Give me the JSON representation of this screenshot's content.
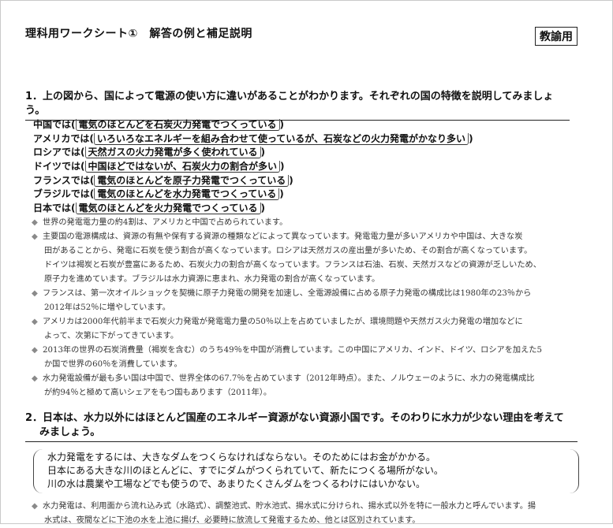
{
  "header": {
    "title": "理科用ワークシート①　解答の例と補足説明",
    "badge": "教諭用"
  },
  "q1": {
    "question": "1．上の図から、国によって電源の使い方に違いがあることがわかります。それぞれの国の特徴を説明してみましょう。",
    "answers": [
      {
        "country": "中国では",
        "answer": "電気のほとんどを石炭火力発電でつくっている"
      },
      {
        "country": "アメリカでは",
        "answer": "いろいろなエネルギーを組み合わせて使っているが、石炭などの火力発電がかなり多い"
      },
      {
        "country": "ロシアでは",
        "answer": "天然ガスの火力発電が多く使われている"
      },
      {
        "country": "ドイツでは",
        "answer": "中国ほどではないが、石炭火力の割合が多い"
      },
      {
        "country": "フランスでは",
        "answer": "電気のほとんどを原子力発電でつくっている"
      },
      {
        "country": "ブラジルでは",
        "answer": "電気のほとんどを水力発電でつくっている"
      },
      {
        "country": "日本では",
        "answer": "電気のほとんどを火力発電でつくっている"
      }
    ],
    "notes": [
      {
        "marker": "◆",
        "text": "世界の発電電力量の約4割は、アメリカと中国で占められています。"
      },
      {
        "marker": "◆",
        "text": "主要国の電源構成は、資源の有無や保有する資源の種類などによって異なっています。発電電力量が多いアメリカや中国は、大きな炭"
      },
      {
        "marker": "",
        "text": "田があることから、発電に石炭を使う割合が高くなっています。ロシアは天然ガスの産出量が多いため、その割合が高くなっています。"
      },
      {
        "marker": "",
        "text": "ドイツは褐炭と石炭が豊富にあるため、石炭火力の割合が高くなっています。フランスは石油、石炭、天然ガスなどの資源が乏しいため、"
      },
      {
        "marker": "",
        "text": "原子力を進めています。ブラジルは水力資源に恵まれ、水力発電の割合が高くなっています。"
      },
      {
        "marker": "◆",
        "text": "フランスは、第一次オイルショックを契機に原子力発電の開発を加速し、全電源設備に占める原子力発電の構成比は1980年の23％から"
      },
      {
        "marker": "",
        "text": "2012年は52％に増やしています。"
      },
      {
        "marker": "◆",
        "text": "アメリカは2000年代前半まで石炭火力発電が発電電力量の50％以上を占めていましたが、環境問題や天然ガス火力発電の増加などに"
      },
      {
        "marker": "",
        "text": "よって、次第に下がってきています。"
      },
      {
        "marker": "◆",
        "text": "2013年の世界の石炭消費量（褐炭を含む）のうち49％を中国が消費しています。この中国にアメリカ、インド、ドイツ、ロシアを加えた5"
      },
      {
        "marker": "",
        "text": "か国で世界の60％を消費しています。"
      },
      {
        "marker": "◆",
        "text": "水力発電設備が最も多い国は中国で、世界全体の67.7％を占めています（2012年時点）。また、ノルウェーのように、水力の発電構成比"
      },
      {
        "marker": "",
        "text": "が約94％と極めて高いシェアをもつ国もあります（2011年）。"
      }
    ]
  },
  "q2": {
    "question_line1": "2．日本は、水力以外にはほとんど国産のエネルギー資源がない資源小国です。そのわりに水力が少ない理由を考えて",
    "question_line2": "みましょう。",
    "answer_lines": [
      "水力発電をするには、大きなダムをつくらなければならない。そのためにはお金がかかる。",
      "日本にある大きな川のほとんどに、すでにダムがつくられていて、新たにつくる場所がない。",
      "川の水は農業や工場などでも使うので、あまりたくさんダムをつくるわけにはいかない。"
    ],
    "notes": [
      {
        "marker": "◆",
        "text": "水力発電は、利用面から流れ込み式（水路式）、調整池式、貯水池式、揚水式に分けられ、揚水式以外を特に一般水力と呼んでいます。揚"
      },
      {
        "marker": "",
        "text": "水式は、夜間などに下池の水を上池に揚げ、必要時に放流して発電するため、他とは区別されています。"
      }
    ]
  }
}
